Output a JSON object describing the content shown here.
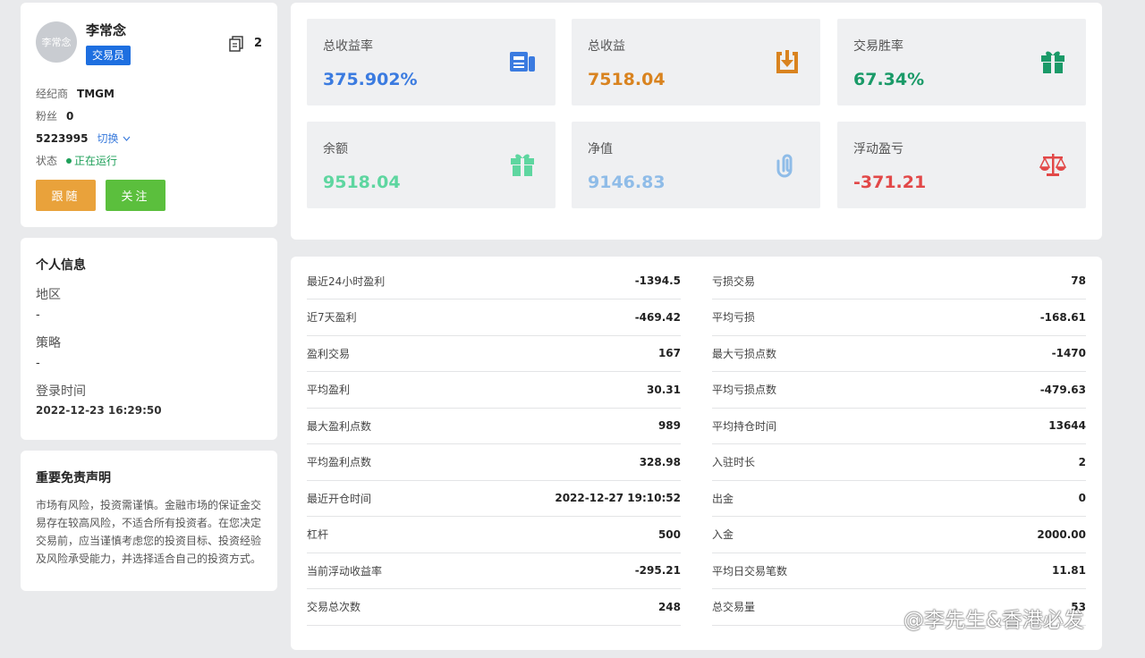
{
  "profile": {
    "avatar_text": "李常念",
    "name": "李常念",
    "role": "交易员",
    "copy_count": "2",
    "broker_label": "经纪商",
    "broker_value": "TMGM",
    "fans_label": "粉丝",
    "fans_value": "0",
    "account": "5223995",
    "switch_label": "切换",
    "status_label": "状态",
    "status_value": "正在运行",
    "follow_button": "跟随",
    "watch_button": "关注"
  },
  "info": {
    "title": "个人信息",
    "region_label": "地区",
    "region_value": "-",
    "strategy_label": "策略",
    "strategy_value": "-",
    "login_label": "登录时间",
    "login_value": "2022-12-23 16:29:50"
  },
  "disclaimer": {
    "title": "重要免责声明",
    "text": "市场有风险，投资需谨慎。金融市场的保证金交易存在较高风险，不适合所有投资者。在您决定交易前，应当谨慎考虑您的投资目标、投资经验及风险承受能力，并选择适合自己的投资方式。"
  },
  "stats": [
    {
      "label": "总收益率",
      "value": "375.902%",
      "color": "#3b7be0",
      "icon": "news-icon"
    },
    {
      "label": "总收益",
      "value": "7518.04",
      "color": "#d9831f",
      "icon": "download-icon"
    },
    {
      "label": "交易胜率",
      "value": "67.34%",
      "color": "#1a9a68",
      "icon": "gift-icon"
    },
    {
      "label": "余额",
      "value": "9518.04",
      "color": "#5ed6a0",
      "icon": "gift-icon"
    },
    {
      "label": "净值",
      "value": "9146.83",
      "color": "#8fbce8",
      "icon": "paperclip-icon"
    },
    {
      "label": "浮动盈亏",
      "value": "-371.21",
      "color": "#e24848",
      "icon": "scale-icon"
    }
  ],
  "details": {
    "left": [
      {
        "label": "最近24小时盈利",
        "value": "-1394.5"
      },
      {
        "label": "近7天盈利",
        "value": "-469.42"
      },
      {
        "label": "盈利交易",
        "value": "167"
      },
      {
        "label": "平均盈利",
        "value": "30.31"
      },
      {
        "label": "最大盈利点数",
        "value": "989"
      },
      {
        "label": "平均盈利点数",
        "value": "328.98"
      },
      {
        "label": "最近开仓时间",
        "value": "2022-12-27 19:10:52"
      },
      {
        "label": "杠杆",
        "value": "500"
      },
      {
        "label": "当前浮动收益率",
        "value": "-295.21"
      },
      {
        "label": "交易总次数",
        "value": "248"
      }
    ],
    "right": [
      {
        "label": "亏损交易",
        "value": "78"
      },
      {
        "label": "平均亏损",
        "value": "-168.61"
      },
      {
        "label": "最大亏损点数",
        "value": "-1470"
      },
      {
        "label": "平均亏损点数",
        "value": "-479.63"
      },
      {
        "label": "平均持仓时间",
        "value": "13644"
      },
      {
        "label": "入驻时长",
        "value": "2"
      },
      {
        "label": "出金",
        "value": "0"
      },
      {
        "label": "入金",
        "value": "2000.00"
      },
      {
        "label": "平均日交易笔数",
        "value": "11.81"
      },
      {
        "label": "总交易量",
        "value": "53"
      }
    ]
  },
  "watermark": "@李先生&香港必发"
}
